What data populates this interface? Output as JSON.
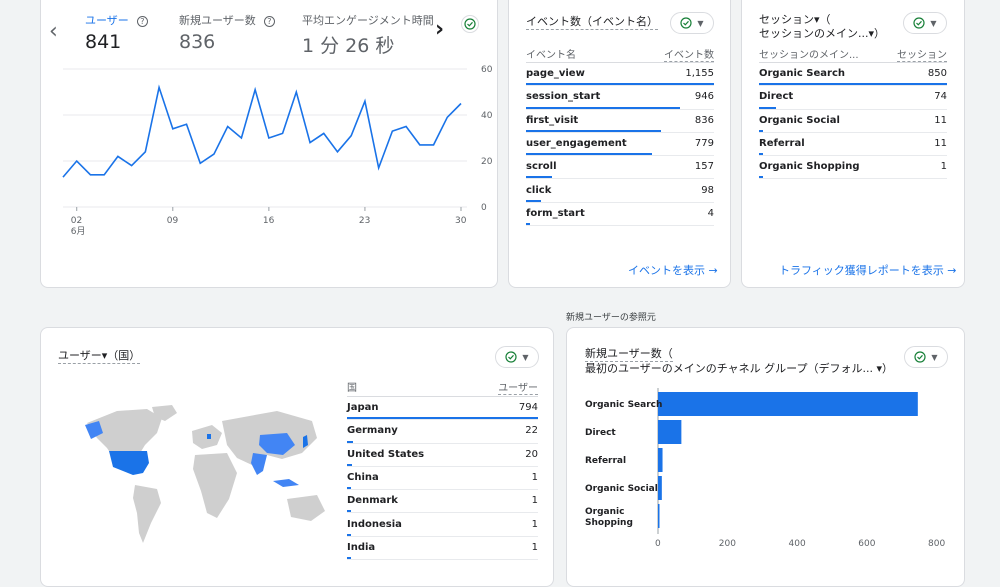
{
  "overview": {
    "metrics": [
      {
        "label": "ユーザー",
        "value": "841",
        "active": true
      },
      {
        "label": "新規ユーザー数",
        "value": "836",
        "active": false
      },
      {
        "label": "平均エンゲージメント時間",
        "value": "1 分 26 秒",
        "active": false
      }
    ],
    "nav_prev": "‹",
    "nav_next": "›",
    "chart": {
      "type": "line",
      "y_ticks": [
        "60",
        "40",
        "20",
        "0"
      ],
      "x_ticks": [
        "02",
        "09",
        "16",
        "23",
        "30"
      ],
      "x_month": "6月"
    }
  },
  "events": {
    "title": "イベント数（イベント名）",
    "col_name": "イベント名",
    "col_value": "イベント数",
    "rows": [
      {
        "label": "page_view",
        "value": "1,155",
        "ratio": 1.0
      },
      {
        "label": "session_start",
        "value": "946",
        "ratio": 0.82
      },
      {
        "label": "first_visit",
        "value": "836",
        "ratio": 0.72
      },
      {
        "label": "user_engagement",
        "value": "779",
        "ratio": 0.67
      },
      {
        "label": "scroll",
        "value": "157",
        "ratio": 0.14
      },
      {
        "label": "click",
        "value": "98",
        "ratio": 0.08
      },
      {
        "label": "form_start",
        "value": "4",
        "ratio": 0.01
      }
    ],
    "link": "イベントを表示 →"
  },
  "sessions": {
    "title_line1": "セッション▾（",
    "title_line2": "セッションのメイン...▾）",
    "col_name": "セッションのメイン...",
    "col_value": "セッション",
    "rows": [
      {
        "label": "Organic Search",
        "value": "850",
        "ratio": 1.0
      },
      {
        "label": "Direct",
        "value": "74",
        "ratio": 0.09
      },
      {
        "label": "Organic Social",
        "value": "11",
        "ratio": 0.013
      },
      {
        "label": "Referral",
        "value": "11",
        "ratio": 0.013
      },
      {
        "label": "Organic Shopping",
        "value": "1",
        "ratio": 0.001
      }
    ],
    "link": "トラフィック獲得レポートを表示 →"
  },
  "section_label": "新規ユーザーの参照元",
  "country": {
    "title": "ユーザー▾（国）",
    "col_name": "国",
    "col_value": "ユーザー",
    "rows": [
      {
        "label": "Japan",
        "value": "794",
        "ratio": 1.0
      },
      {
        "label": "Germany",
        "value": "22",
        "ratio": 0.03
      },
      {
        "label": "United States",
        "value": "20",
        "ratio": 0.025
      },
      {
        "label": "China",
        "value": "1",
        "ratio": 0.001
      },
      {
        "label": "Denmark",
        "value": "1",
        "ratio": 0.001
      },
      {
        "label": "Indonesia",
        "value": "1",
        "ratio": 0.001
      },
      {
        "label": "India",
        "value": "1",
        "ratio": 0.001
      }
    ]
  },
  "new_users": {
    "title_line1": "新規ユーザー数（",
    "title_line2": "最初のユーザーのメインのチャネル グループ（デフォル...  ▾）"
  },
  "chart_data": [
    {
      "type": "line",
      "series": [
        {
          "name": "ユーザー",
          "values": [
            13,
            20,
            14,
            14,
            22,
            18,
            24,
            52,
            34,
            36,
            19,
            23,
            35,
            30,
            51,
            30,
            32,
            50,
            28,
            32,
            24,
            31,
            46,
            17,
            33,
            35,
            27,
            27,
            39,
            45
          ]
        }
      ],
      "x": [
        1,
        2,
        3,
        4,
        5,
        6,
        7,
        8,
        9,
        10,
        11,
        12,
        13,
        14,
        15,
        16,
        17,
        18,
        19,
        20,
        21,
        22,
        23,
        24,
        25,
        26,
        27,
        28,
        29,
        30
      ],
      "x_tick_labels": [
        "02",
        "09",
        "16",
        "23",
        "30"
      ],
      "ylim": [
        0,
        60
      ],
      "y_ticks": [
        0,
        20,
        40,
        60
      ],
      "grid": true
    },
    {
      "type": "bar",
      "orientation": "horizontal",
      "categories": [
        "Organic Search",
        "Direct",
        "Referral",
        "Organic Social",
        "Organic Shopping"
      ],
      "values": [
        745,
        67,
        13,
        11,
        1
      ],
      "xlim": [
        0,
        800
      ],
      "x_ticks": [
        0,
        200,
        400,
        600,
        800
      ],
      "color": "#1a73e8"
    }
  ],
  "colors": {
    "accent": "#1a73e8",
    "check": "#188038"
  }
}
